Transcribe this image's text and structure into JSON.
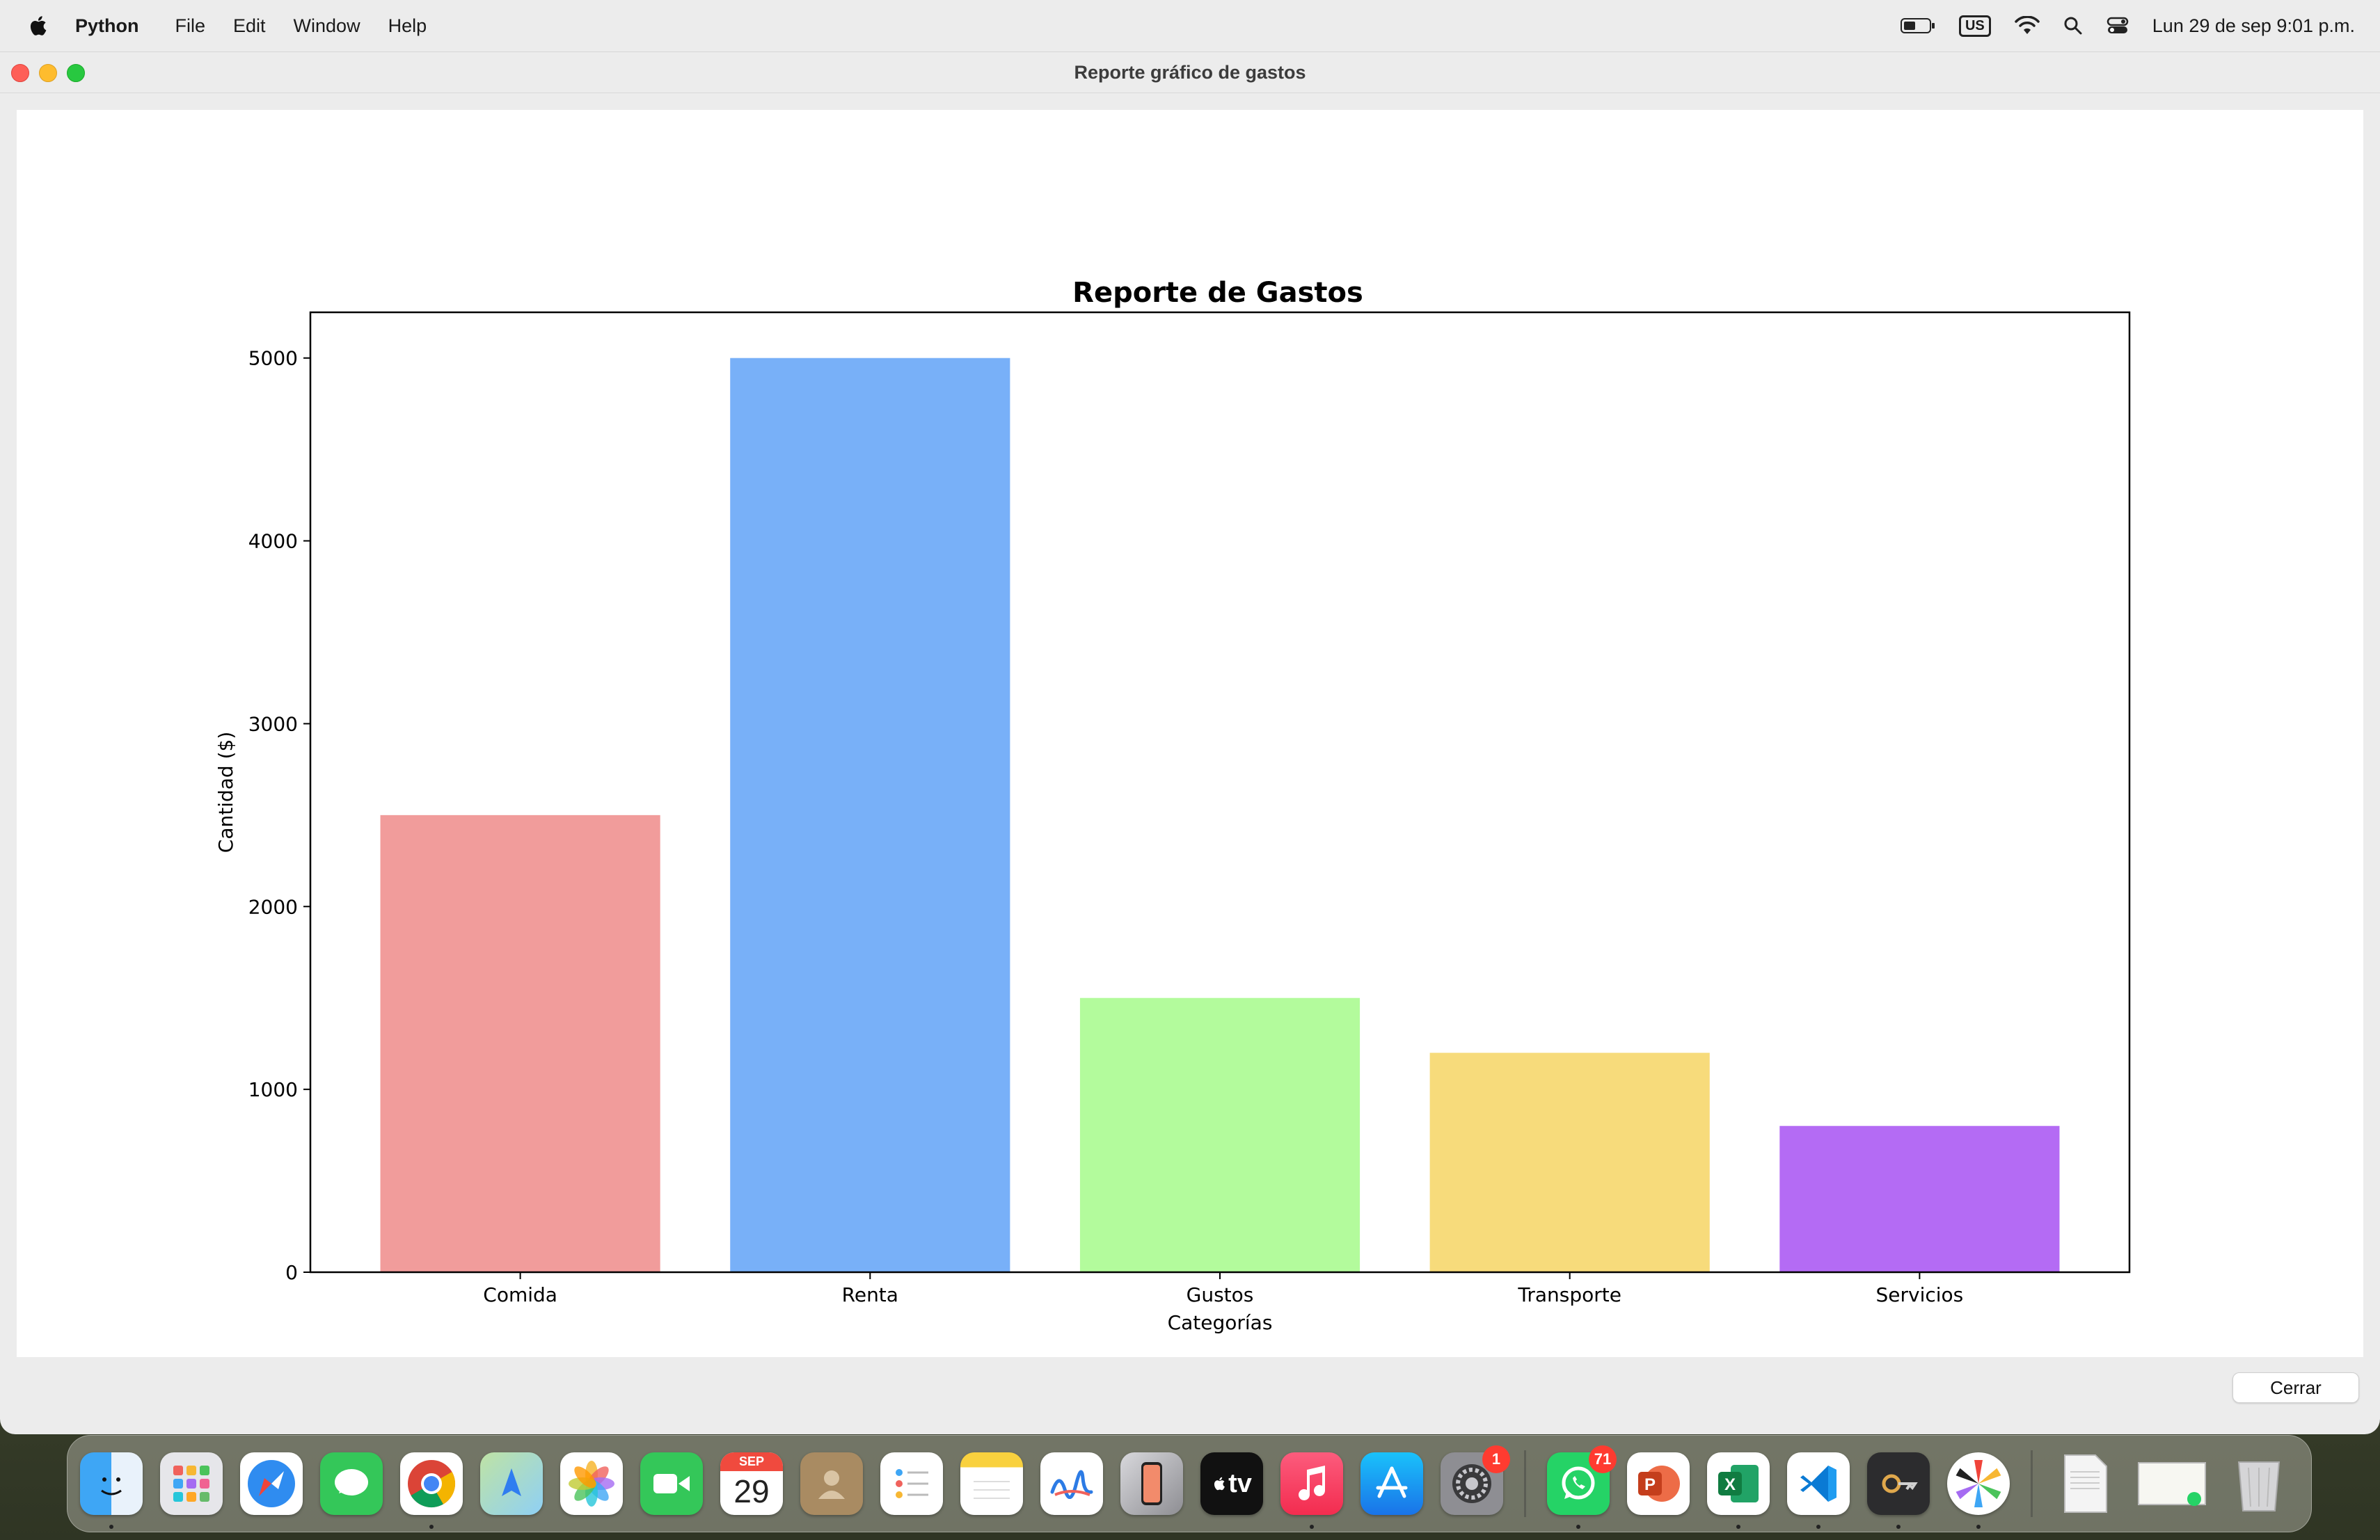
{
  "menubar": {
    "app_name": "Python",
    "items": [
      "File",
      "Edit",
      "Window",
      "Help"
    ],
    "keyboard": "US",
    "datetime": "Lun 29 de sep  9:01 p.m."
  },
  "window": {
    "title": "Reporte gráfico de gastos",
    "close_button": "Cerrar"
  },
  "chart_data": {
    "type": "bar",
    "title": "Reporte de Gastos",
    "xlabel": "Categorías",
    "ylabel": "Cantidad ($)",
    "categories": [
      "Comida",
      "Renta",
      "Gustos",
      "Transporte",
      "Servicios"
    ],
    "values": [
      2500,
      5000,
      1500,
      1200,
      800
    ],
    "colors": [
      "#f19c9b",
      "#78b0f8",
      "#b3fb9c",
      "#f7db7b",
      "#b46bf4"
    ],
    "ylim": [
      0,
      5250
    ],
    "yticks": [
      0,
      1000,
      2000,
      3000,
      4000,
      5000
    ],
    "grid": false
  },
  "dock": {
    "calendar_month": "SEP",
    "calendar_day": "29",
    "whatsapp_badge": "71",
    "settings_badge": "1",
    "tv_label": "tv",
    "icons": [
      "finder-icon",
      "launchpad-icon",
      "safari-icon",
      "messages-icon",
      "chrome-icon",
      "maps-icon",
      "photos-icon",
      "facetime-icon",
      "calendar-icon",
      "contacts-icon",
      "reminders-icon",
      "notes-icon",
      "freeform-icon",
      "iphone-mirroring-icon",
      "apple-tv-icon",
      "music-icon",
      "app-store-icon",
      "system-settings-icon",
      "whatsapp-icon",
      "powerpoint-icon",
      "excel-icon",
      "vscode-icon",
      "keychain-icon",
      "pinwheel-icon",
      "document-icon",
      "image-file-icon",
      "trash-icon"
    ]
  }
}
